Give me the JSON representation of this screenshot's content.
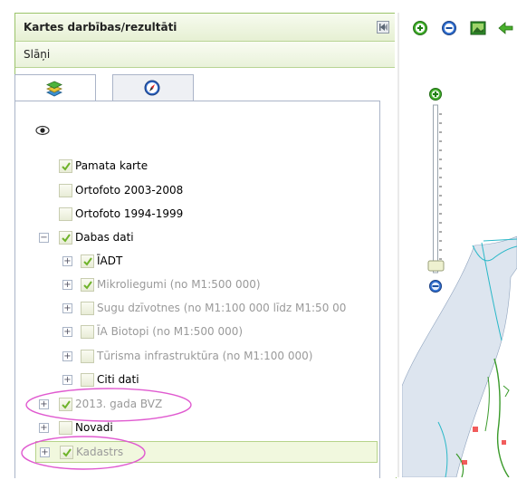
{
  "panel": {
    "title": "Kartes darbības/rezultāti",
    "section": "Slāņi"
  },
  "tabs": [
    {
      "icon": "layers-icon",
      "active": true
    },
    {
      "icon": "compass-icon",
      "active": false
    }
  ],
  "layers": [
    {
      "label": "Pamata karte",
      "checked": true,
      "dim": false
    },
    {
      "label": "Ortofoto 2003-2008",
      "checked": false,
      "dim": false
    },
    {
      "label": "Ortofoto 1994-1999",
      "checked": false,
      "dim": false
    },
    {
      "label": "Dabas dati",
      "checked": true,
      "dim": false,
      "expanded": true
    },
    {
      "label": "ĪADT",
      "checked": true,
      "dim": false
    },
    {
      "label": "Mikroliegumi (no M1:500 000)",
      "checked": true,
      "dim": true
    },
    {
      "label": "Sugu dzīvotnes (no M1:100 000 līdz M1:50 00",
      "checked": false,
      "dim": true
    },
    {
      "label": "ĪA Biotopi (no M1:500 000)",
      "checked": false,
      "dim": true
    },
    {
      "label": "Tūrisma infrastruktūra (no M1:100 000)",
      "checked": false,
      "dim": true
    },
    {
      "label": "Citi dati",
      "checked": false,
      "dim": false
    },
    {
      "label": "2013. gada BVZ",
      "checked": true,
      "dim": true
    },
    {
      "label": "Novadi",
      "checked": false,
      "dim": false
    },
    {
      "label": "Kadastrs",
      "checked": true,
      "dim": true
    }
  ],
  "map_toolbar": [
    "zoom-in-icon",
    "zoom-out-icon",
    "image-icon",
    "pan-arrow-icon"
  ],
  "colors": {
    "panel_border": "#9bc46a",
    "annotation": "#e05ad0",
    "sea": "#ffffff",
    "land": "#dde5ef",
    "boundary": "#2bb8c8"
  }
}
